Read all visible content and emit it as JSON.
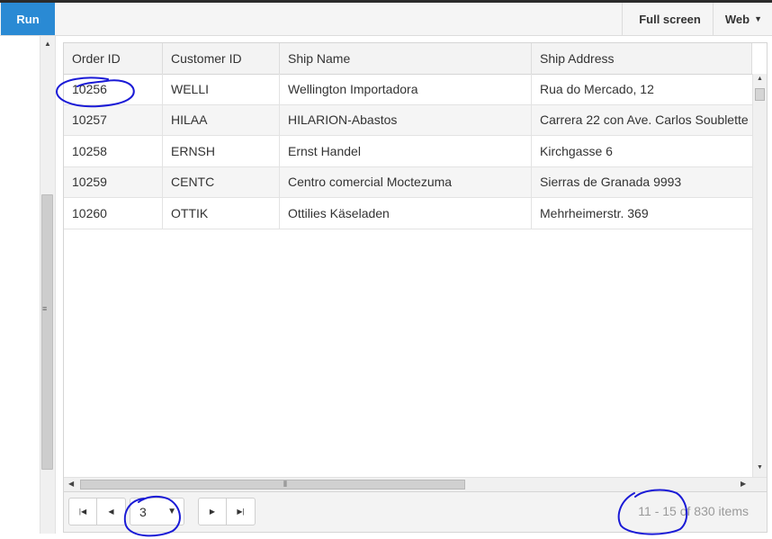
{
  "toolbar": {
    "run_label": "Run",
    "fullscreen_label": "Full screen",
    "web_label": "Web"
  },
  "grid": {
    "columns": [
      "Order ID",
      "Customer ID",
      "Ship Name",
      "Ship Address"
    ],
    "rows": [
      [
        "10256",
        "WELLI",
        "Wellington Importadora",
        "Rua do Mercado, 12"
      ],
      [
        "10257",
        "HILAA",
        "HILARION-Abastos",
        "Carrera 22 con Ave. Carlos Soublette"
      ],
      [
        "10258",
        "ERNSH",
        "Ernst Handel",
        "Kirchgasse 6"
      ],
      [
        "10259",
        "CENTC",
        "Centro comercial Moctezuma",
        "Sierras de Granada 9993"
      ],
      [
        "10260",
        "OTTIK",
        "Ottilies Käseladen",
        "Mehrheimerstr. 369"
      ]
    ]
  },
  "pager": {
    "current_page": "3",
    "info": "11 - 15 of 830 items"
  },
  "colors": {
    "run_button": "#2a8ad4",
    "annotation_ink": "#1a1ad6"
  }
}
